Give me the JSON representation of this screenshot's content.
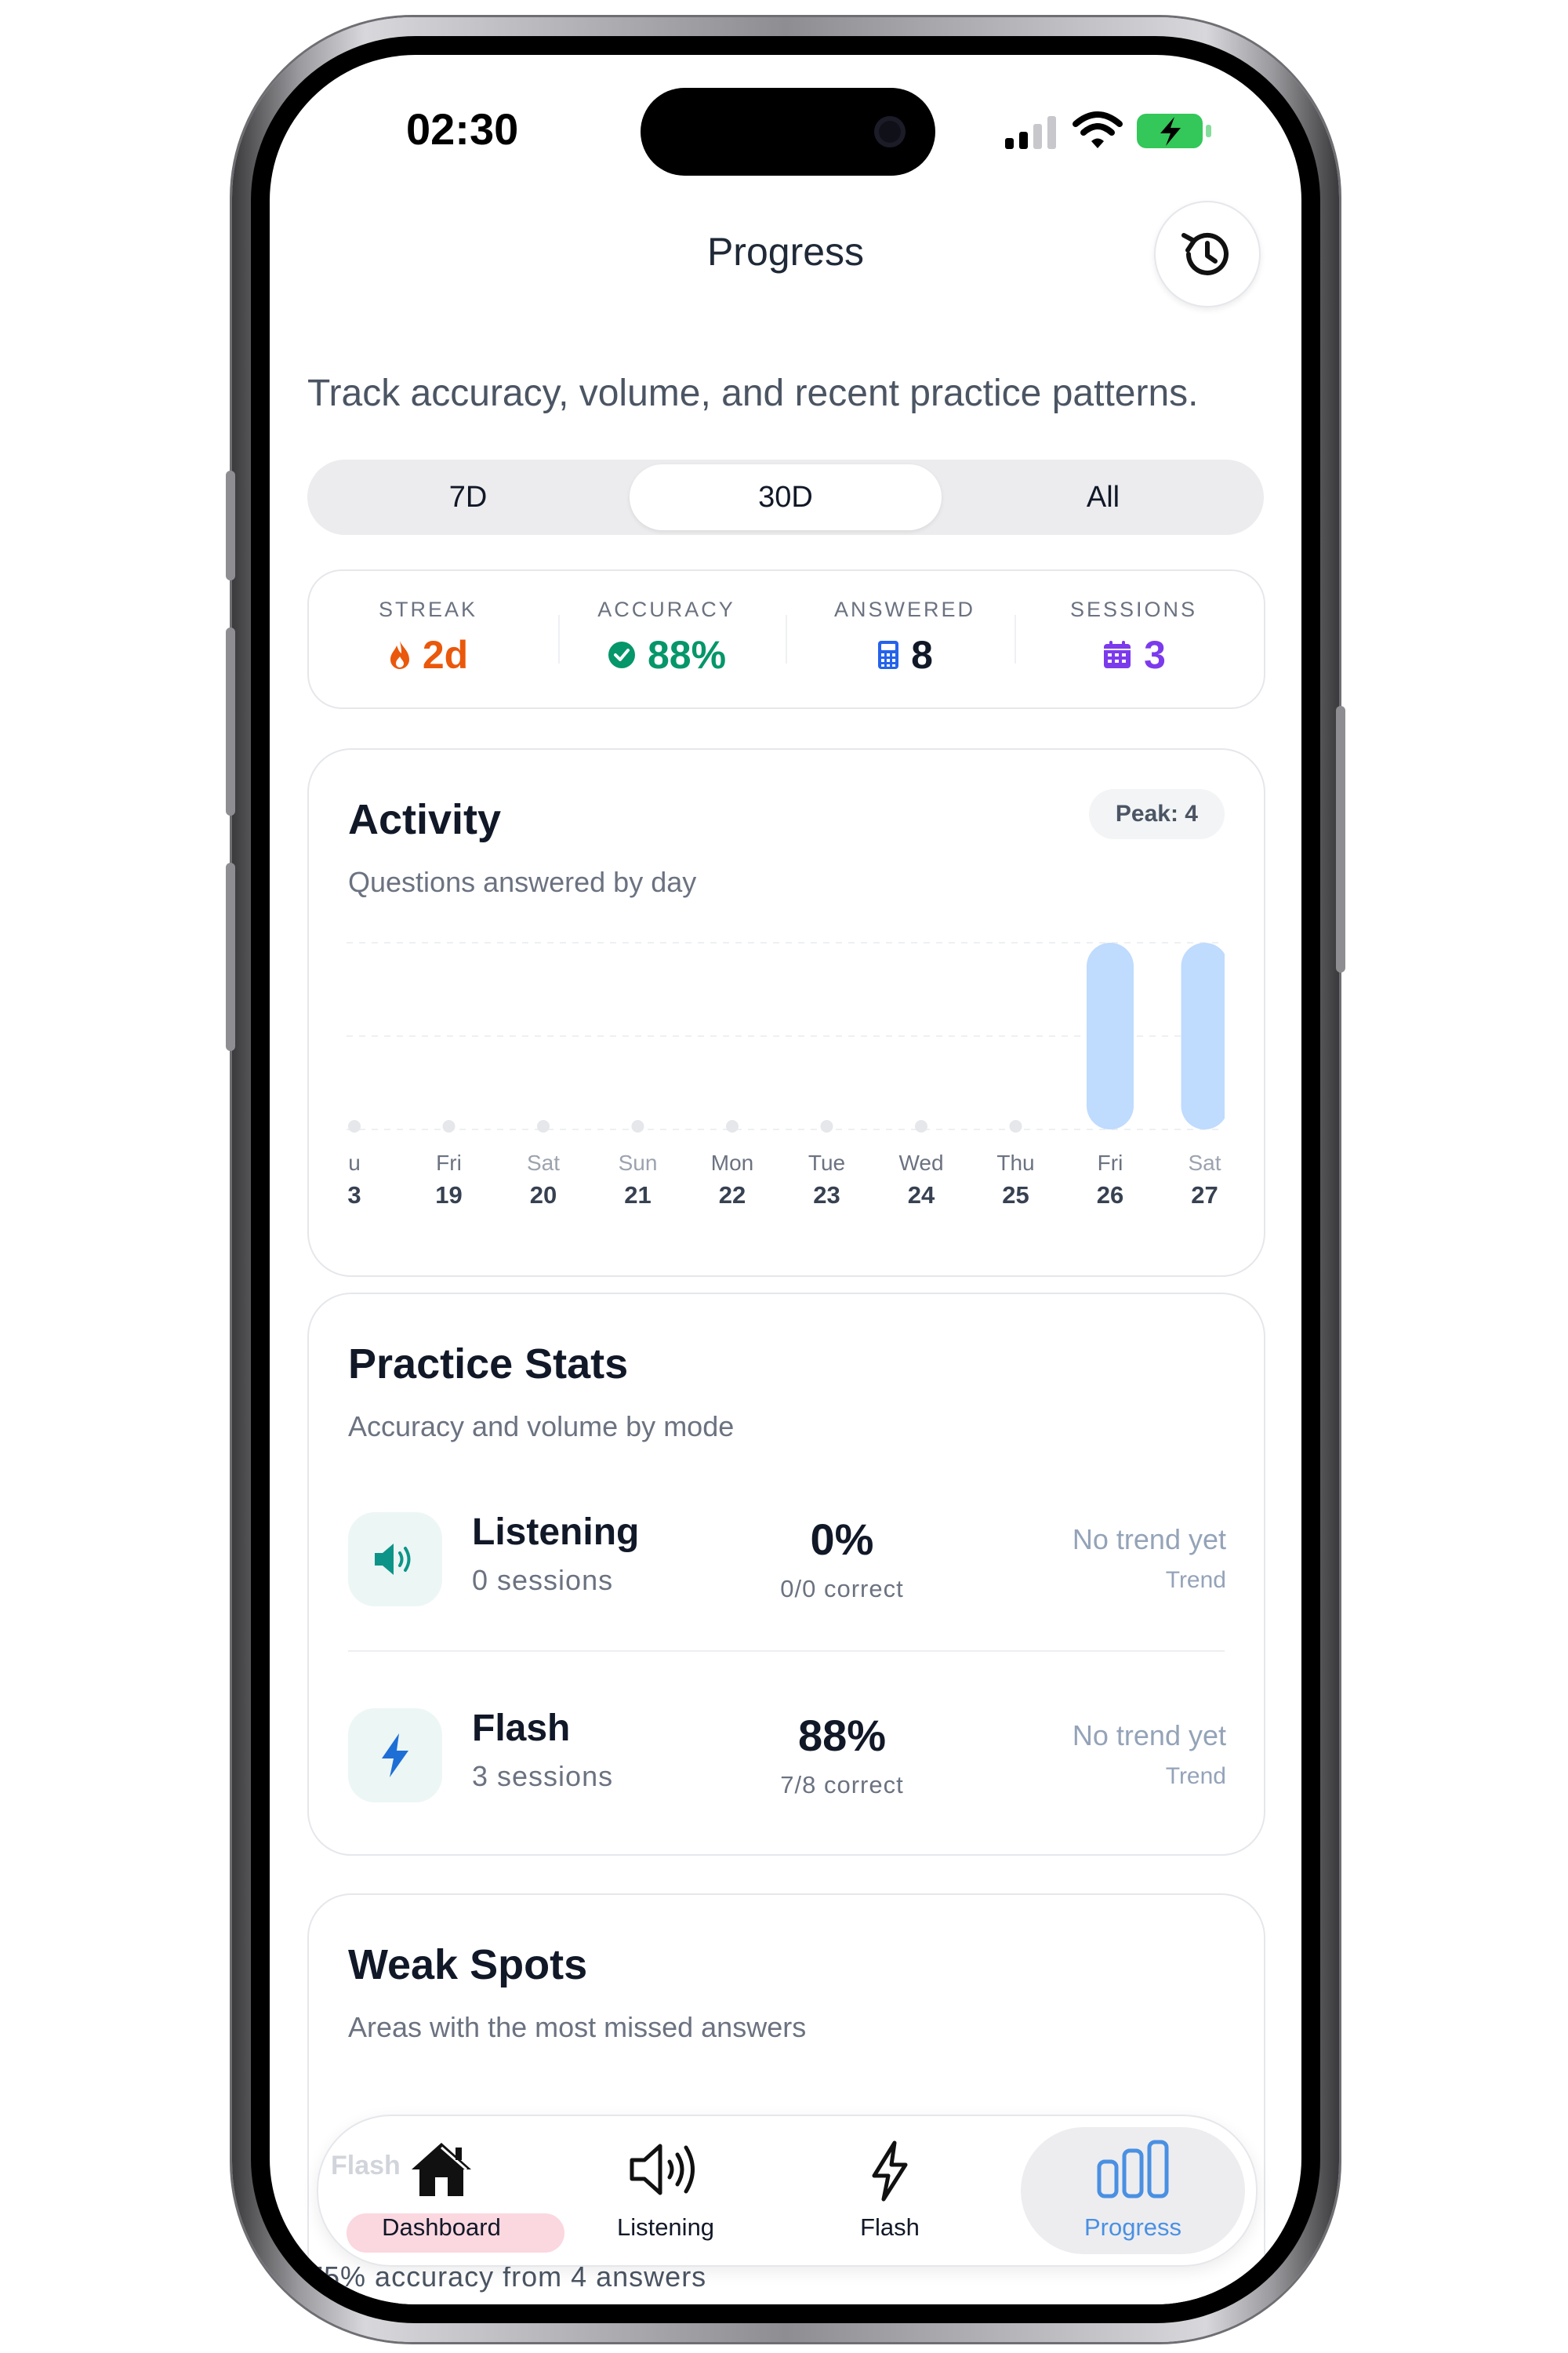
{
  "status_bar": {
    "time": "02:30"
  },
  "header": {
    "title": "Progress",
    "subtitle": "Track accuracy, volume, and recent practice patterns."
  },
  "range_selector": {
    "options": [
      "7D",
      "30D",
      "All"
    ],
    "selected": "30D"
  },
  "summary": {
    "streak": {
      "label": "STREAK",
      "value": "2d",
      "color": "#ea580c",
      "icon": "flame-icon"
    },
    "accuracy": {
      "label": "ACCURACY",
      "value": "88%",
      "color": "#059669",
      "icon": "check-circle-icon"
    },
    "answered": {
      "label": "ANSWERED",
      "value": "8",
      "color": "#111827",
      "icon": "calculator-icon"
    },
    "sessions": {
      "label": "SESSIONS",
      "value": "3",
      "color": "#7c3aed",
      "icon": "calendar-icon"
    }
  },
  "activity": {
    "title": "Activity",
    "subtitle": "Questions answered by day",
    "peak_label": "Peak: 4"
  },
  "chart_data": {
    "type": "bar",
    "title": "Activity",
    "subtitle": "Questions answered by day",
    "categories": [
      "u 3",
      "Fri 19",
      "Sat 20",
      "Sun 21",
      "Mon 22",
      "Tue 23",
      "Wed 24",
      "Thu 25",
      "Fri 26",
      "Sat 27"
    ],
    "days": [
      "u",
      "Fri",
      "Sat",
      "Sun",
      "Mon",
      "Tue",
      "Wed",
      "Thu",
      "Fri",
      "Sat"
    ],
    "dates": [
      "3",
      "19",
      "20",
      "21",
      "22",
      "23",
      "24",
      "25",
      "26",
      "27"
    ],
    "values": [
      0,
      0,
      0,
      0,
      0,
      0,
      0,
      0,
      4,
      4
    ],
    "ylim": [
      0,
      4
    ],
    "grid": true,
    "bar_color": "#bfdbfe",
    "empty_dot_color": "#e5e7eb",
    "weekend_label_color": "#9ca3af",
    "weekday_label_color": "#6b7280"
  },
  "practice": {
    "title": "Practice Stats",
    "subtitle": "Accuracy and volume by mode",
    "modes": [
      {
        "name": "Listening",
        "sessions": "0 sessions",
        "pct": "0%",
        "correct": "0/0 correct",
        "trend": "No trend yet",
        "trend_label": "Trend",
        "icon": "speaker-icon",
        "icon_color": "#0d9488"
      },
      {
        "name": "Flash",
        "sessions": "3 sessions",
        "pct": "88%",
        "correct": "7/8 correct",
        "trend": "No trend yet",
        "trend_label": "Trend",
        "icon": "lightning-icon",
        "icon_color": "#1d6fd6"
      }
    ]
  },
  "weak_spots": {
    "title": "Weak Spots",
    "subtitle": "Areas with the most missed answers",
    "item_desc": "75% accuracy from 4 answers"
  },
  "tab_bar": {
    "flash_ghost": "Flash",
    "tabs": [
      {
        "label": "Dashboard",
        "icon": "house-icon"
      },
      {
        "label": "Listening",
        "icon": "speaker-icon"
      },
      {
        "label": "Flash",
        "icon": "lightning-icon"
      },
      {
        "label": "Progress",
        "icon": "bar-chart-icon"
      }
    ],
    "active": "Progress",
    "active_color": "#4a90e2"
  }
}
